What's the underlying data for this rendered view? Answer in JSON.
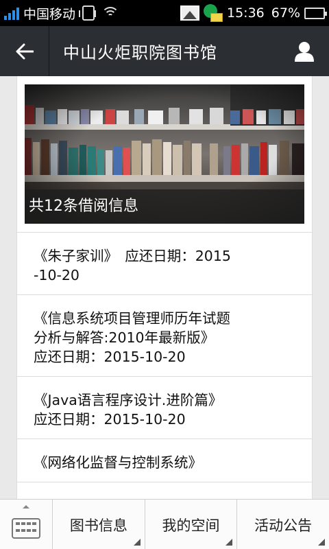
{
  "status_bar": {
    "carrier": "中国移动",
    "time": "15:36",
    "battery_pct": "67%",
    "battery_level": 0.67,
    "icons": [
      "signal-icon",
      "vibrate-icon",
      "wifi-icon",
      "gallery-notification-icon",
      "message-notification-icon",
      "battery-icon"
    ]
  },
  "header": {
    "back_icon": "back-arrow-icon",
    "title": "中山火炬职院图书馆",
    "user_icon": "user-icon"
  },
  "banner": {
    "caption": "共12条借阅信息"
  },
  "loans": [
    {
      "text": "《朱子家训》　应还日期：2015-10-20"
    },
    {
      "text": "《信息系统项目管理师历年试题分析与解答:2010年最新版》　应还日期：2015-10-20"
    },
    {
      "text": "《Java语言程序设计.进阶篇》　应还日期：2015-10-20"
    },
    {
      "text": "《网络化监督与控制系统》"
    }
  ],
  "bottom_nav": {
    "keyboard_icon": "keyboard-icon",
    "items": [
      {
        "label": "图书信息"
      },
      {
        "label": "我的空间"
      },
      {
        "label": "活动公告"
      }
    ]
  },
  "colors": {
    "header_bg": "#2b2f33",
    "status_bg": "#000000",
    "signal": "#2f8ee6",
    "battery": "#3ec43e"
  }
}
